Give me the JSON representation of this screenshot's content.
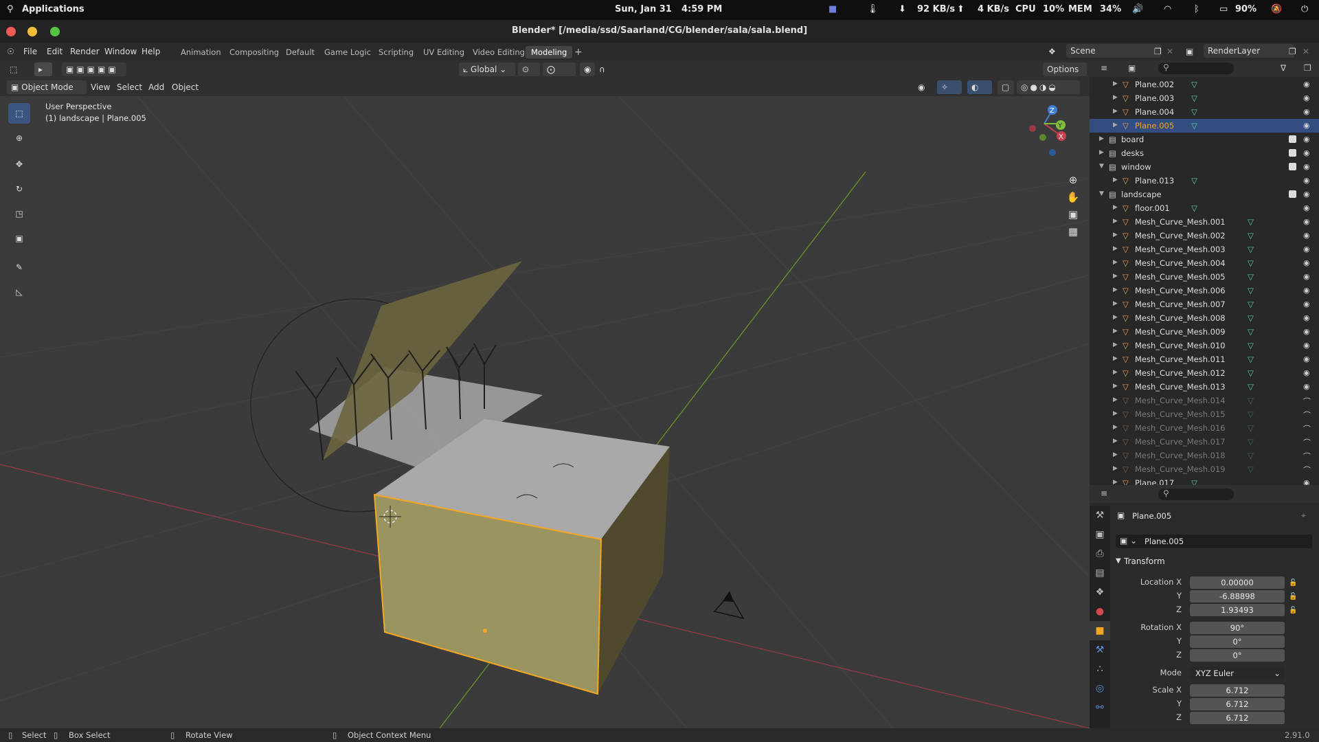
{
  "system_bar": {
    "apps_label": "Applications",
    "date": "Sun, Jan 31",
    "time": "4:59 PM",
    "net_down": "92 KB/s",
    "net_up": "4 KB/s",
    "cpu_label": "CPU",
    "cpu_value": "10%",
    "mem_label": "MEM",
    "mem_value": "34%",
    "battery": "90%"
  },
  "window": {
    "title": "Blender* [/media/ssd/Saarland/CG/blender/sala/sala.blend]"
  },
  "menu": {
    "items": [
      "File",
      "Edit",
      "Render",
      "Window",
      "Help"
    ],
    "workspaces": [
      "Animation",
      "Compositing",
      "Default",
      "Game Logic",
      "Scripting",
      "UV Editing",
      "Video Editing",
      "Modeling"
    ],
    "active_workspace": "Modeling",
    "scene_label": "Scene",
    "render_layer_label": "RenderLayer"
  },
  "tool_header": {
    "orientation": "Global",
    "options_label": "Options"
  },
  "mode_header": {
    "mode": "Object Mode",
    "view": "View",
    "select": "Select",
    "add": "Add",
    "object": "Object"
  },
  "viewport": {
    "perspective": "User Perspective",
    "context": "(1) landscape | Plane.005",
    "gizmo_x": "X",
    "gizmo_y": "Y",
    "gizmo_z": "Z"
  },
  "outliner": {
    "rows": [
      {
        "label": "Plane.002",
        "indent": 2,
        "kind": "mesh",
        "selected": false,
        "dim": false
      },
      {
        "label": "Plane.003",
        "indent": 2,
        "kind": "mesh",
        "selected": false,
        "dim": false
      },
      {
        "label": "Plane.004",
        "indent": 2,
        "kind": "mesh",
        "selected": false,
        "dim": false
      },
      {
        "label": "Plane.005",
        "indent": 2,
        "kind": "mesh",
        "selected": true,
        "dim": false
      },
      {
        "label": "board",
        "indent": 1,
        "kind": "collection",
        "selected": false,
        "dim": false
      },
      {
        "label": "desks",
        "indent": 1,
        "kind": "collection",
        "selected": false,
        "dim": false
      },
      {
        "label": "window",
        "indent": 1,
        "kind": "collection",
        "selected": false,
        "dim": false
      },
      {
        "label": "Plane.013",
        "indent": 2,
        "kind": "mesh",
        "selected": false,
        "dim": false
      },
      {
        "label": "landscape",
        "indent": 1,
        "kind": "collection",
        "selected": false,
        "dim": false
      },
      {
        "label": "floor.001",
        "indent": 2,
        "kind": "mesh",
        "selected": false,
        "dim": false
      },
      {
        "label": "Mesh_Curve_Mesh.001",
        "indent": 2,
        "kind": "mesh",
        "selected": false,
        "dim": false
      },
      {
        "label": "Mesh_Curve_Mesh.002",
        "indent": 2,
        "kind": "mesh",
        "selected": false,
        "dim": false
      },
      {
        "label": "Mesh_Curve_Mesh.003",
        "indent": 2,
        "kind": "mesh",
        "selected": false,
        "dim": false
      },
      {
        "label": "Mesh_Curve_Mesh.004",
        "indent": 2,
        "kind": "mesh",
        "selected": false,
        "dim": false
      },
      {
        "label": "Mesh_Curve_Mesh.005",
        "indent": 2,
        "kind": "mesh",
        "selected": false,
        "dim": false
      },
      {
        "label": "Mesh_Curve_Mesh.006",
        "indent": 2,
        "kind": "mesh",
        "selected": false,
        "dim": false
      },
      {
        "label": "Mesh_Curve_Mesh.007",
        "indent": 2,
        "kind": "mesh",
        "selected": false,
        "dim": false
      },
      {
        "label": "Mesh_Curve_Mesh.008",
        "indent": 2,
        "kind": "mesh",
        "selected": false,
        "dim": false
      },
      {
        "label": "Mesh_Curve_Mesh.009",
        "indent": 2,
        "kind": "mesh",
        "selected": false,
        "dim": false
      },
      {
        "label": "Mesh_Curve_Mesh.010",
        "indent": 2,
        "kind": "mesh",
        "selected": false,
        "dim": false
      },
      {
        "label": "Mesh_Curve_Mesh.011",
        "indent": 2,
        "kind": "mesh",
        "selected": false,
        "dim": false
      },
      {
        "label": "Mesh_Curve_Mesh.012",
        "indent": 2,
        "kind": "mesh",
        "selected": false,
        "dim": false
      },
      {
        "label": "Mesh_Curve_Mesh.013",
        "indent": 2,
        "kind": "mesh",
        "selected": false,
        "dim": false
      },
      {
        "label": "Mesh_Curve_Mesh.014",
        "indent": 2,
        "kind": "mesh",
        "selected": false,
        "dim": true
      },
      {
        "label": "Mesh_Curve_Mesh.015",
        "indent": 2,
        "kind": "mesh",
        "selected": false,
        "dim": true
      },
      {
        "label": "Mesh_Curve_Mesh.016",
        "indent": 2,
        "kind": "mesh",
        "selected": false,
        "dim": true
      },
      {
        "label": "Mesh_Curve_Mesh.017",
        "indent": 2,
        "kind": "mesh",
        "selected": false,
        "dim": true
      },
      {
        "label": "Mesh_Curve_Mesh.018",
        "indent": 2,
        "kind": "mesh",
        "selected": false,
        "dim": true
      },
      {
        "label": "Mesh_Curve_Mesh.019",
        "indent": 2,
        "kind": "mesh",
        "selected": false,
        "dim": true
      },
      {
        "label": "Plane.017",
        "indent": 2,
        "kind": "mesh",
        "selected": false,
        "dim": false
      }
    ]
  },
  "properties": {
    "object_name": "Plane.005",
    "object_field": "Plane.005",
    "section": "Transform",
    "location_label": "Location X",
    "location": [
      "0.00000",
      "-6.88898",
      "1.93493"
    ],
    "rotation_label": "Rotation X",
    "rotation": [
      "90°",
      "0°",
      "0°"
    ],
    "mode_label": "Mode",
    "mode_value": "XYZ Euler",
    "scale_label": "Scale X",
    "scale": [
      "6.712",
      "6.712",
      "6.712"
    ],
    "axis_y": "Y",
    "axis_z": "Z"
  },
  "status_bar": {
    "select": "Select",
    "box_select": "Box Select",
    "rotate_view": "Rotate View",
    "context_menu": "Object Context Menu",
    "version": "2.91.0"
  },
  "colors": {
    "accent_selected": "#334d80",
    "object_outline": "#f5a623",
    "mesh_icon": "#e5a15a",
    "data_icon": "#5fd19a",
    "x_axis": "#c8414f",
    "y_axis": "#7fbf3a",
    "z_axis": "#3f7fd6"
  }
}
